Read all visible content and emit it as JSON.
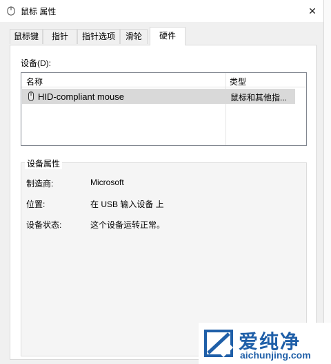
{
  "window": {
    "title": "鼠标 属性",
    "close_glyph": "✕"
  },
  "tabs": [
    {
      "label": "鼠标键"
    },
    {
      "label": "指针"
    },
    {
      "label": "指针选项"
    },
    {
      "label": "滑轮"
    },
    {
      "label": "硬件",
      "active": true
    }
  ],
  "devices": {
    "label": "设备(D):",
    "columns": {
      "name": "名称",
      "type": "类型"
    },
    "rows": [
      {
        "name": "HID-compliant mouse",
        "type": "鼠标和其他指...",
        "icon": "mouse-icon",
        "selected": true
      }
    ]
  },
  "properties": {
    "title": "设备属性",
    "items": [
      {
        "label": "制造商:",
        "value": "Microsoft"
      },
      {
        "label": "位置:",
        "value": "在 USB 输入设备 上"
      },
      {
        "label": "设备状态:",
        "value": "这个设备运转正常。"
      }
    ]
  },
  "watermark": {
    "text": "爱纯净",
    "url": "aichunjing.com",
    "color": "#1f5fa8"
  },
  "colors": {
    "selection": "#d9d9d9",
    "panel_bg": "#ffffff",
    "window_bg": "#f0f0f0"
  }
}
